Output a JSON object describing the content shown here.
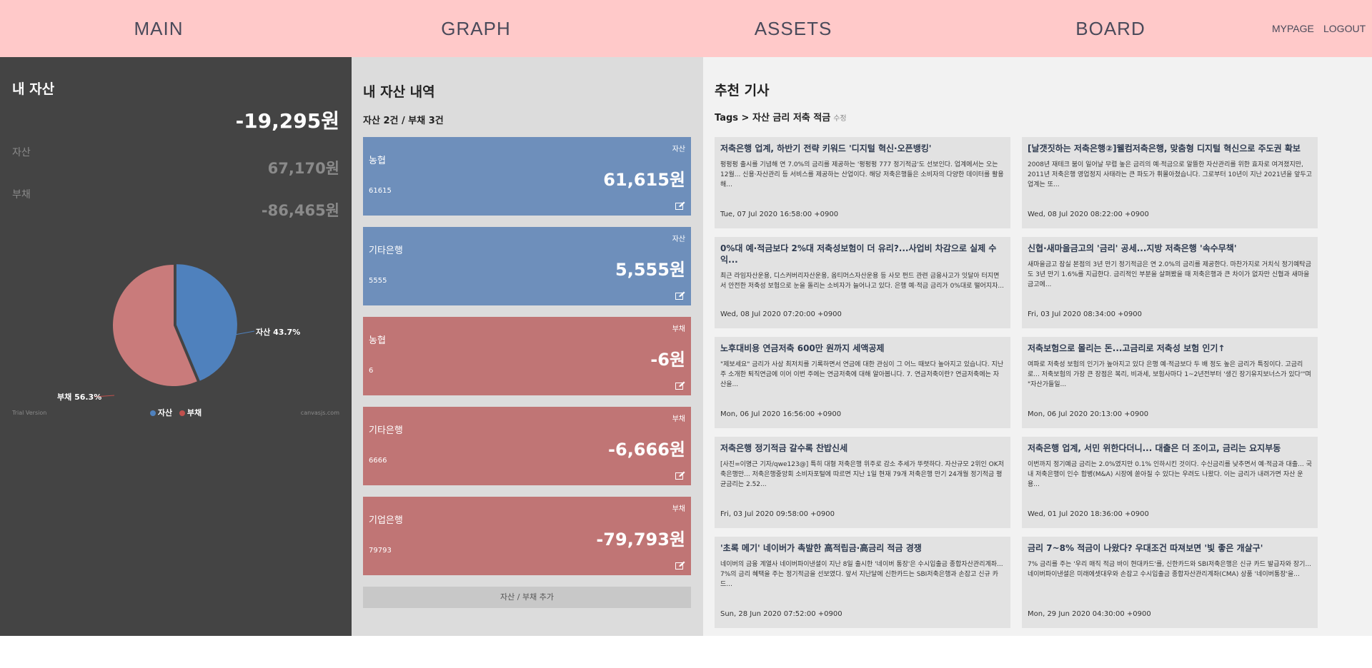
{
  "nav": {
    "main": "MAIN",
    "graph": "GRAPH",
    "assets": "ASSETS",
    "board": "BOARD",
    "mypage": "MYPAGE",
    "logout": "LOGOUT"
  },
  "summary": {
    "title": "내 자산",
    "total": "-19,295원",
    "asset_label": "자산",
    "asset_amount": "67,170원",
    "debt_label": "부채",
    "debt_amount": "-86,465원",
    "pie": {
      "asset_label": "자산 43.7%",
      "debt_label": "부채 56.3%",
      "asset_pct": 43.7,
      "debt_pct": 56.3,
      "asset_color": "#4f81bd",
      "debt_color": "#c0504d"
    },
    "legend_asset": "자산",
    "legend_debt": "부채",
    "trial": "Trial Version",
    "credit": "canvasjs.com"
  },
  "ledger": {
    "title": "내 자산 내역",
    "subtitle": "자산 2건 / 부채 3건",
    "items": [
      {
        "kind": "자산",
        "name": "농협",
        "value": "61,615원",
        "raw": "61615"
      },
      {
        "kind": "자산",
        "name": "기타은행",
        "value": "5,555원",
        "raw": "5555"
      },
      {
        "kind": "부채",
        "name": "농협",
        "value": "-6원",
        "raw": "6"
      },
      {
        "kind": "부채",
        "name": "기타은행",
        "value": "-6,666원",
        "raw": "6666"
      },
      {
        "kind": "부채",
        "name": "기업은행",
        "value": "-79,793원",
        "raw": "79793"
      }
    ],
    "add_label": "자산 / 부채 추가"
  },
  "news": {
    "title": "추천 기사",
    "tags": "Tags > 자산 금리 저축 적금",
    "tags_edit": "수정",
    "articles": [
      {
        "title": "저축은행 업계, 하반기 전략 키워드 '디지털 혁신·오픈뱅킹'",
        "body": "펑펑펑 출시를 기념해 연 7.0%의 금리를 제공하는 '펑펑펑 777 정기적금'도 선보인다. 업계에서는 오는 12월... 신용·자산관리 등 서비스를 제공하는 산업이다. 해당 저축은행들은 소비자의 다양한 데이터를 활용해...",
        "date": "Tue, 07 Jul 2020 16:58:00 +0900"
      },
      {
        "title": "[날갯짓하는 저축은행②]웰컴저축은행, 맞춤형 디지털 혁신으로 주도권 확보",
        "body": "2008년 재테크 붐이 일어날 무렵 높은 금리의 예·적금으로 알뜰한 자산관리를 위한 효자로 여겨졌지만, 2011년 저축은행 영업정지 사태라는 큰 파도가 휘몰아쳤습니다. 그로부터 10년이 지난 2021년을 앞두고 업계는 또...",
        "date": "Wed, 08 Jul 2020 08:22:00 +0900"
      },
      {
        "title": "0%대 예·적금보다 2%대 저축성보험이 더 유리?...사업비 차감으로 실제 수익...",
        "body": "최근 라임자산운용, 디스커버리자산운용, 옵티머스자산운용 등 사모 펀드 관련 금융사고가 잇달아 터지면서 안전한 저축성 보험으로 눈을 돌리는 소비자가 늘어나고 있다. 은행 예·적금 금리가 0%대로 떨어지자...",
        "date": "Wed, 08 Jul 2020 07:20:00 +0900"
      },
      {
        "title": "신협·새마을금고의 '금리' 공세...지방 저축은행 '속수무책'",
        "body": "새마을금고 잠실 본점의 3년 만기 정기적금은 연 2.0%의 금리를 제공한다. 마찬가지로 거치식 정기예탁금도 3년 만기 1.6%를 지급한다. 금리적인 부분을 살펴봤을 때 저축은행과 큰 차이가 없자만 신협과 새마을금고에...",
        "date": "Fri, 03 Jul 2020 08:34:00 +0900"
      },
      {
        "title": "노후대비용 연금저축 600만 원까지 세액공제",
        "body": "\"제보세요\" 금리가 사상 최저치를 기록하면서 연금에 대한 관심이 그 어느 때보다 높아지고 있습니다. 지난주 소개한 퇴직연금에 이어 이번 주에는 연금저축에 대해 알아봅니다. 7. 연금저축이란? 연금저축에는 자산을...",
        "date": "Mon, 06 Jul 2020 16:56:00 +0900"
      },
      {
        "title": "저축보험으로 몰리는 돈...고금리로 저축성 보험 인기↑",
        "body": "여파로 저축성 보험의 인기가 높아지고 있다 은행 예·적금보다 두 배 정도 높은 금리가 특징이다. 고금리로... 저축보험의 가장 큰 장점은 복리, 비과세, 보험사마다 1~2년전부터 '생긴 장기유지보너스가 있다'\"며 \"자산가들일...",
        "date": "Mon, 06 Jul 2020 20:13:00 +0900"
      },
      {
        "title": "저축은행 정기적금 갈수록 찬밥신세",
        "body": "[사진=이명근 기자/qwe123@] 특히 대형 저축은행 위주로 감소 추세가 뚜렷하다. 자산규모 2위인 OK저축은행만... 저축은행중앙회 소비자포털에 따르면 지난 1일 현재 79개 저축은행 만기 24개월 정기적금 평균금리는 2.52...",
        "date": "Fri, 03 Jul 2020 09:58:00 +0900"
      },
      {
        "title": "저축은행 업계, 서민 위한다더니... 대출은 더 조이고, 금리는 요지부동",
        "body": "이번까지 정기예금 금리는 2.0%였지만 0.1% 인하시킨 것이다. 수신금리를 낮추면서 예·적금과 대출... 국내 저축은행이 인수 합병(M&A) 시장에 쏟아질 수 있다는 우려도 나왔다. 이는 금리가 내려가면 자산 운용...",
        "date": "Wed, 01 Jul 2020 18:36:00 +0900"
      },
      {
        "title": "'초록 메기' 네이버가 촉발한 高적립금·高금리 적금 경쟁",
        "body": "네이버의 금융 계열사 네이버파이낸셜이 지난 8일 출시한 '네이버 통장'은 수시입출금 종합자산관리계좌... 7%의 금리 혜택을 주는 정기적금을 선보였다. 앞서 지난달에 신한카드는 SBI저축은행과 손잡고 신규 카드...",
        "date": "Sun, 28 Jun 2020 07:52:00 +0900"
      },
      {
        "title": "금리 7~8% 적금이 나왔다? 우대조건 따져보면 '빛 좋은 개살구'",
        "body": "7% 금리를 주는 '우리 매직 적금 바이 현대카드'를, 신한카드와 SBI저축은행은 신규 카드 발급자와 장기... 네이버파이낸셜은 미래에셋대우와 손잡고 수시입출금 종합자산관리계좌(CMA) 상품 '네이버통장'을...",
        "date": "Mon, 29 Jun 2020 04:30:00 +0900"
      }
    ]
  }
}
